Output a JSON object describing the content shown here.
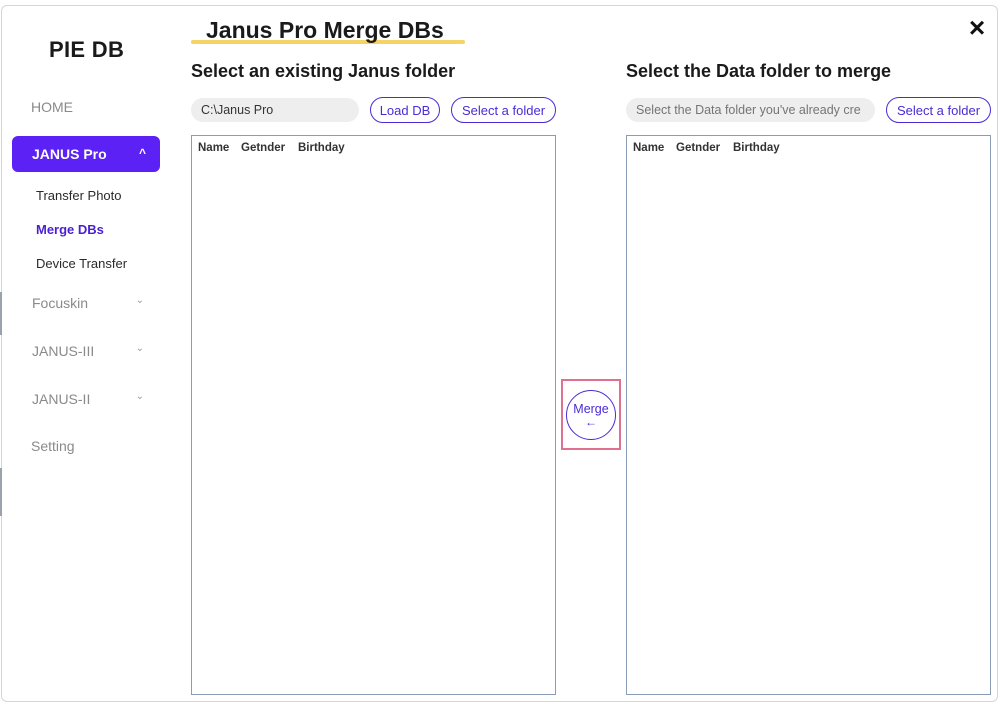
{
  "app": {
    "title": "PIE DB",
    "close_icon": "×"
  },
  "sidebar": {
    "home": "HOME",
    "active_group": {
      "label": "JANUS Pro",
      "chevron": "^"
    },
    "sub_items": [
      "Transfer Photo",
      "Merge DBs",
      "Device Transfer"
    ],
    "groups": [
      "Focuskin",
      "JANUS-III",
      "JANUS-II"
    ],
    "group_chevron": "⌄",
    "setting": "Setting"
  },
  "page": {
    "title": "Janus Pro Merge DBs",
    "underline_color": "#f6d365"
  },
  "left_panel": {
    "heading": "Select an existing Janus folder",
    "path_value": "C:\\Janus Pro",
    "load_button": "Load DB",
    "select_button": "Select a folder",
    "columns": [
      "Name",
      "Getnder",
      "Birthday"
    ]
  },
  "right_panel": {
    "heading": "Select the Data folder to merge",
    "path_placeholder": "Select the Data folder you've already cre",
    "select_button": "Select a folder",
    "columns": [
      "Name",
      "Getnder",
      "Birthday"
    ]
  },
  "merge": {
    "label": "Merge",
    "arrow": "←"
  },
  "colors": {
    "accent": "#5b21f5",
    "button_border": "#4a2bd6",
    "highlight": "#e0708f"
  }
}
